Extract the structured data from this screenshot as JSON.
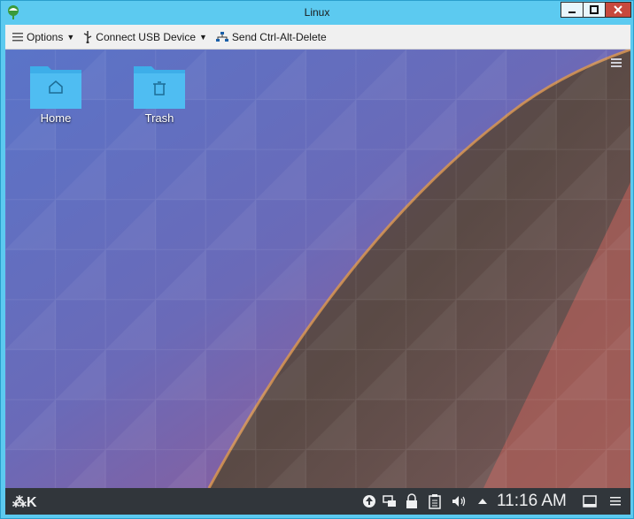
{
  "window": {
    "title": "Linux"
  },
  "toolbar": {
    "options_label": "Options",
    "usb_label": "Connect USB Device",
    "cad_label": "Send Ctrl-Alt-Delete"
  },
  "desktop": {
    "icons": [
      {
        "label": "Home",
        "icon": "home-folder-icon"
      },
      {
        "label": "Trash",
        "icon": "trash-folder-icon"
      }
    ]
  },
  "taskbar": {
    "clock": "11:16 AM",
    "tray_icons": [
      "update-icon",
      "network-icon",
      "lock-icon",
      "clipboard-icon",
      "volume-icon",
      "expand-tray-icon"
    ]
  },
  "colors": {
    "titlebar": "#5ccaf0",
    "close": "#c7493d",
    "taskbar": "#31363b",
    "folder": "#3daee9"
  }
}
